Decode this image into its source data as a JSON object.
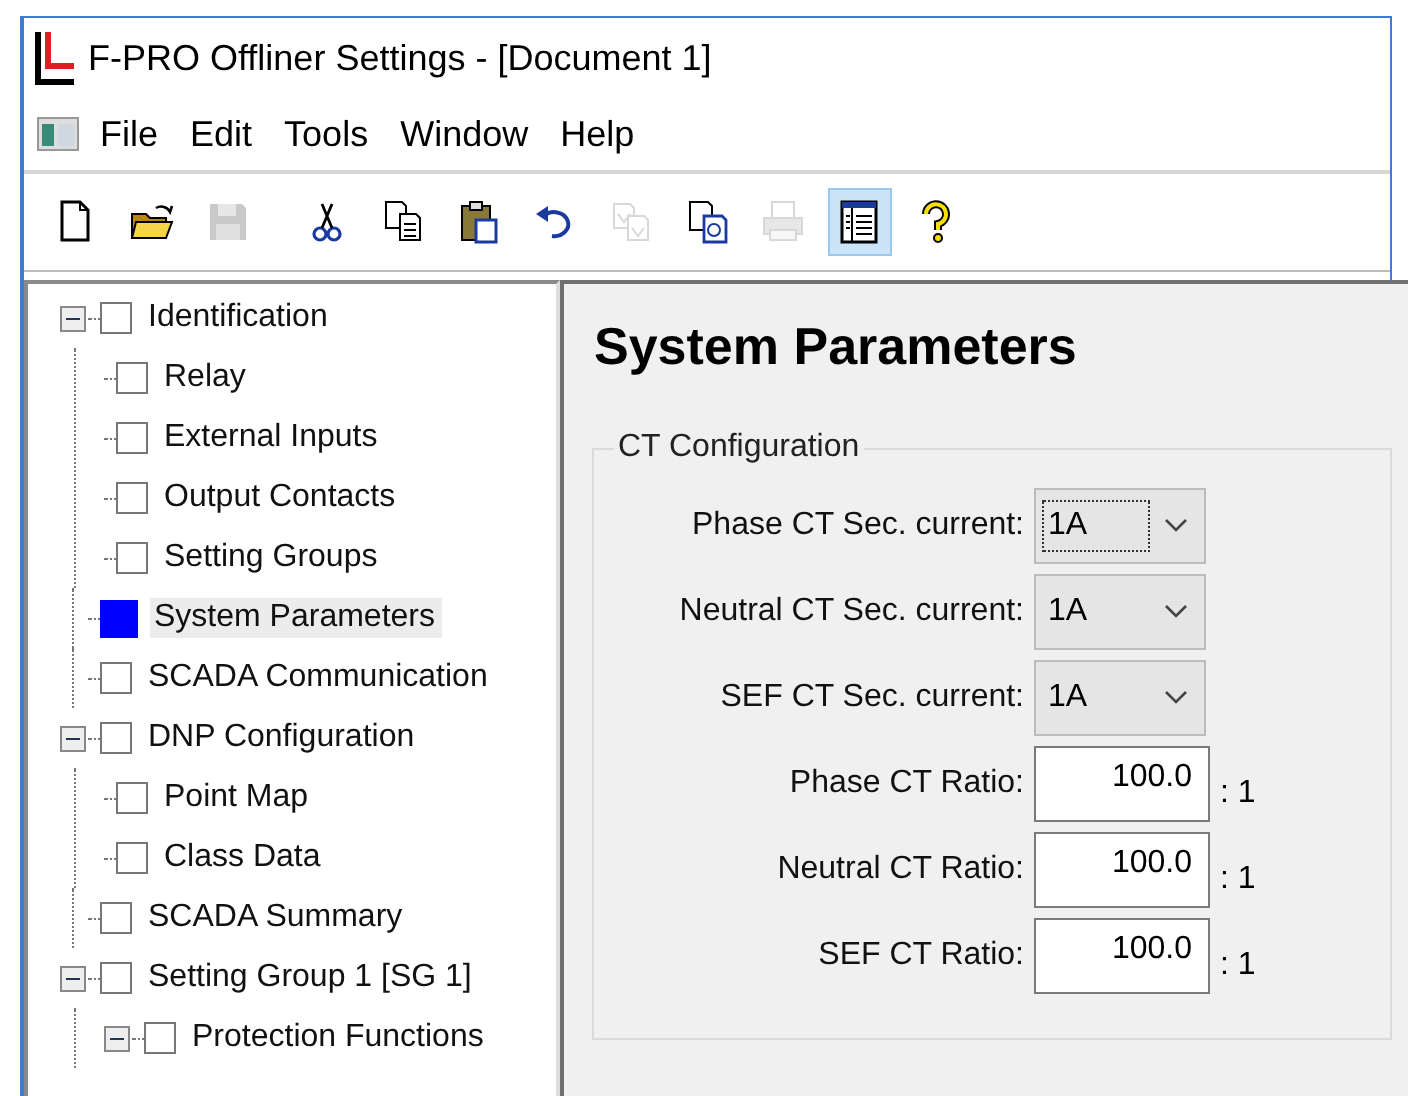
{
  "window": {
    "title": "F-PRO Offliner Settings - [Document 1]"
  },
  "menu": [
    "File",
    "Edit",
    "Tools",
    "Window",
    "Help"
  ],
  "toolbar": [
    {
      "kind": "new",
      "disabled": false,
      "pressed": false
    },
    {
      "kind": "open",
      "disabled": false,
      "pressed": false
    },
    {
      "kind": "save",
      "disabled": true,
      "pressed": false
    },
    {
      "kind": "cut",
      "disabled": false,
      "pressed": false
    },
    {
      "kind": "copy",
      "disabled": false,
      "pressed": false
    },
    {
      "kind": "paste",
      "disabled": false,
      "pressed": false
    },
    {
      "kind": "undo",
      "disabled": false,
      "pressed": false
    },
    {
      "kind": "compare",
      "disabled": true,
      "pressed": false
    },
    {
      "kind": "copy-special",
      "disabled": false,
      "pressed": false
    },
    {
      "kind": "print",
      "disabled": true,
      "pressed": false
    },
    {
      "kind": "view",
      "disabled": false,
      "pressed": true
    },
    {
      "kind": "help",
      "disabled": false,
      "pressed": false
    }
  ],
  "tree": [
    {
      "label": "Identification",
      "selected": false,
      "expanded": true,
      "children": [
        {
          "label": "Relay",
          "selected": false
        },
        {
          "label": "External Inputs",
          "selected": false
        },
        {
          "label": "Output Contacts",
          "selected": false
        },
        {
          "label": "Setting Groups",
          "selected": false
        }
      ]
    },
    {
      "label": "System Parameters",
      "selected": true
    },
    {
      "label": "SCADA Communication",
      "selected": false
    },
    {
      "label": "DNP Configuration",
      "selected": false,
      "expanded": true,
      "children": [
        {
          "label": "Point Map",
          "selected": false
        },
        {
          "label": "Class Data",
          "selected": false
        }
      ]
    },
    {
      "label": "SCADA Summary",
      "selected": false
    },
    {
      "label": "Setting Group 1 [SG 1]",
      "selected": false,
      "expanded": true,
      "children": [
        {
          "label": "Protection Functions",
          "selected": false,
          "expanded": true
        }
      ]
    }
  ],
  "page": {
    "heading": "System Parameters",
    "group": {
      "title": "CT Configuration",
      "fields": [
        {
          "kind": "dropdown",
          "label": "Phase CT Sec. current:",
          "value": "1A",
          "focused": true
        },
        {
          "kind": "dropdown",
          "label": "Neutral CT Sec. current:",
          "value": "1A",
          "focused": false
        },
        {
          "kind": "dropdown",
          "label": "SEF CT Sec. current:",
          "value": "1A",
          "focused": false
        },
        {
          "kind": "number",
          "label": "Phase CT Ratio:",
          "value": "100.0",
          "suffix": ": 1"
        },
        {
          "kind": "number",
          "label": "Neutral CT Ratio:",
          "value": "100.0",
          "suffix": ": 1"
        },
        {
          "kind": "number",
          "label": "SEF CT Ratio:",
          "value": "100.0",
          "suffix": ": 1"
        }
      ]
    }
  }
}
